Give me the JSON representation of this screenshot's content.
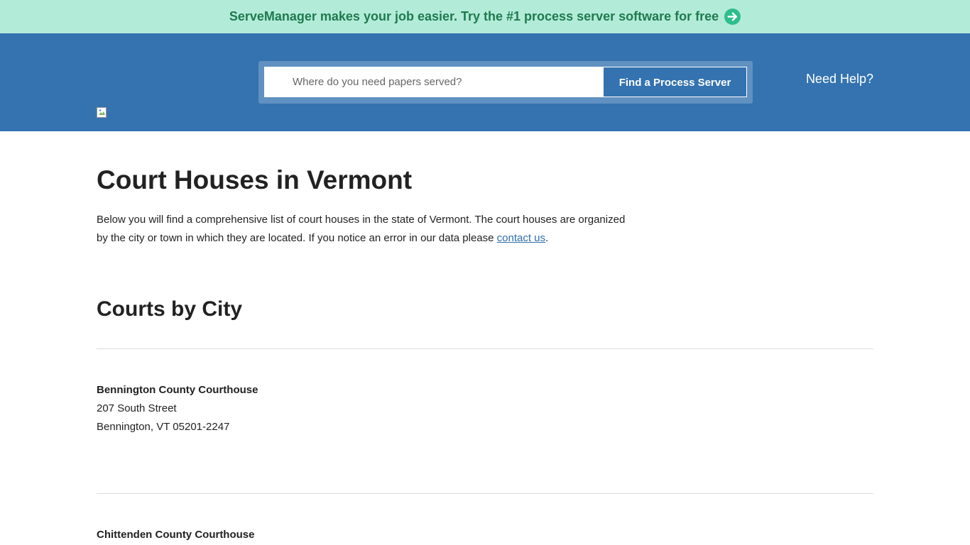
{
  "promo": {
    "text": "ServeManager makes your job easier. Try the #1 process server software for free",
    "icon": "arrow-right-circle-icon",
    "icon_color": "#2dbe8c"
  },
  "header": {
    "background": "#3473b0",
    "search": {
      "placeholder": "Where do you need papers served?",
      "value": "",
      "button_label": "Find a Process Server"
    },
    "help_label": "Need Help?"
  },
  "page": {
    "title": "Court Houses in Vermont",
    "intro_text": "Below you will find a comprehensive list of court houses in the state of Vermont. The court houses are organized by the city or town in which they are located. If you notice an error in our data please",
    "intro_link": "contact us",
    "intro_end": ".",
    "section_title": "Courts by City"
  },
  "courts": [
    {
      "name": "Bennington County Courthouse",
      "street": "207 South Street",
      "city_line": "Bennington, VT 05201-2247"
    },
    {
      "name": "Chittenden County Courthouse",
      "street": "",
      "city_line": ""
    }
  ]
}
